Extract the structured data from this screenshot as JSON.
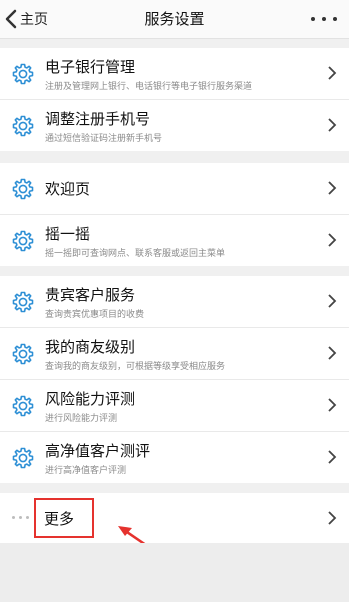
{
  "header": {
    "back_label": "主页",
    "title": "服务设置"
  },
  "groups": [
    {
      "items": [
        {
          "title": "电子银行管理",
          "subtitle": "注册及管理网上银行、电话银行等电子银行服务渠道"
        },
        {
          "title": "调整注册手机号",
          "subtitle": "通过短信验证码注册新手机号"
        }
      ]
    },
    {
      "items": [
        {
          "title": "欢迎页",
          "subtitle": ""
        },
        {
          "title": "摇一摇",
          "subtitle": "摇一摇即可查询网点、联系客服或返回主菜单"
        }
      ]
    },
    {
      "items": [
        {
          "title": "贵宾客户服务",
          "subtitle": "查询贵宾优惠项目的收费"
        },
        {
          "title": "我的商友级别",
          "subtitle": "查询我的商友级别，可根据等级享受相应服务"
        },
        {
          "title": "风险能力评测",
          "subtitle": "进行风险能力评测"
        },
        {
          "title": "高净值客户测评",
          "subtitle": "进行高净值客户评测"
        }
      ]
    }
  ],
  "more": {
    "label": "更多"
  },
  "colors": {
    "icon": "#2d8fd5",
    "highlight": "#e5322e",
    "background": "#f0f0f0"
  },
  "icons": {
    "row_icon": "gear-icon",
    "back_icon": "chevron-left-icon",
    "menu_icon": "more-dots-icon",
    "row_arrow": "chevron-right-icon"
  }
}
